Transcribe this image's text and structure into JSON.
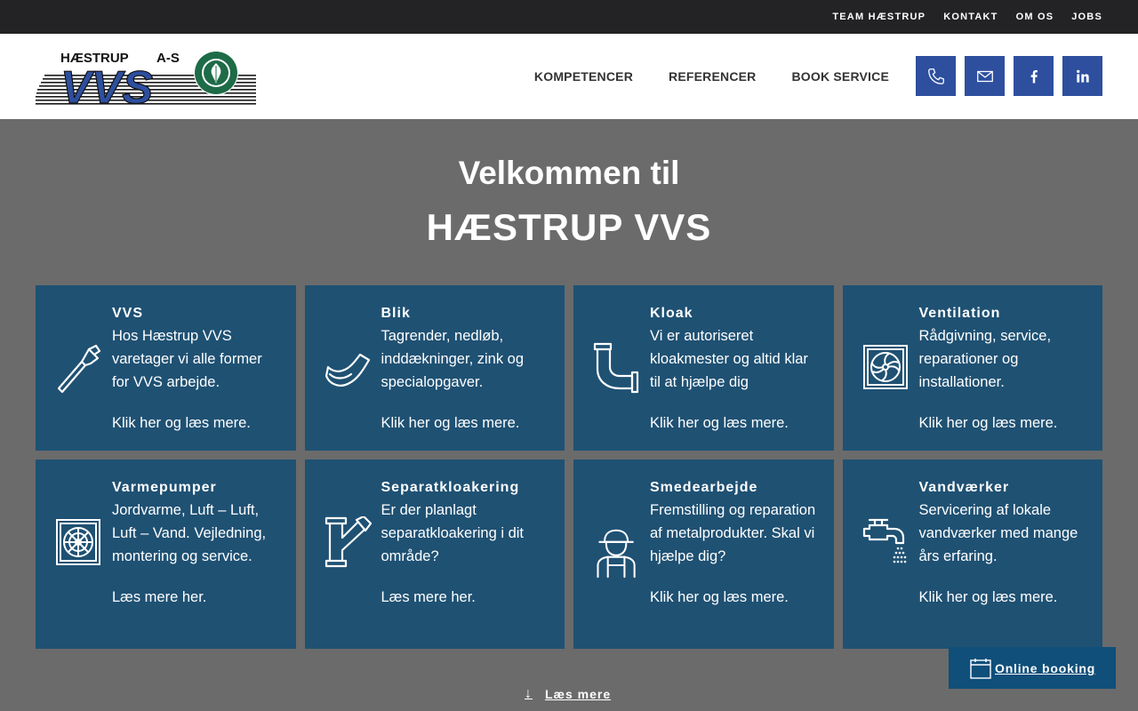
{
  "topnav": [
    "TEAM HÆSTRUP",
    "KONTAKT",
    "OM OS",
    "JOBS"
  ],
  "logo": {
    "text_top": "HÆSTRUP",
    "text_suffix": "A-S",
    "text_main": "VVS",
    "brand_color": "#2d4f9e"
  },
  "mainnav": [
    "KOMPETENCER",
    "REFERENCER",
    "BOOK SERVICE"
  ],
  "socials": [
    {
      "icon": "phone-icon"
    },
    {
      "icon": "mail-icon"
    },
    {
      "icon": "facebook-icon"
    },
    {
      "icon": "linkedin-icon"
    }
  ],
  "hero": {
    "line1": "Velkommen til",
    "line2": "HÆSTRUP VVS"
  },
  "cards": [
    {
      "title": "VVS",
      "text": "Hos Hæstrup VVS varetager vi alle former for VVS arbejde.",
      "link": "Klik her og læs mere.",
      "icon": "pipe-wrench-icon"
    },
    {
      "title": "Blik",
      "text": "Tagrender, nedløb, inddækninger, zink og specialopgaver.",
      "link": "Klik her og læs mere.",
      "icon": "gutter-icon"
    },
    {
      "title": "Kloak",
      "text": "Vi er autoriseret kloakmester og altid klar til at hjælpe dig",
      "link": "Klik her og læs mere.",
      "icon": "pipe-elbow-icon"
    },
    {
      "title": "Ventilation",
      "text": "Rådgivning, service, reparationer og installationer.",
      "link": "Klik her og læs mere.",
      "icon": "ventilation-fan-icon"
    },
    {
      "title": "Varmepumper",
      "text": "Jordvarme, Luft – Luft, Luft – Vand. Vejledning, montering og service.",
      "link": "Læs mere her.",
      "icon": "heat-pump-icon"
    },
    {
      "title": "Separatkloakering",
      "text": "Er der planlagt separatkloakering i dit område?",
      "link": "Læs mere her.",
      "icon": "y-pipe-icon"
    },
    {
      "title": "Smedearbejde",
      "text": "Fremstilling og reparation af metalprodukter. Skal vi hjælpe dig?",
      "link": "Klik her og læs mere.",
      "icon": "worker-icon"
    },
    {
      "title": "Vandværker",
      "text": "Servicering af lokale vandværker med mange års erfaring.",
      "link": "Klik her og læs mere.",
      "icon": "water-tap-icon"
    }
  ],
  "readmore": "Læs mere",
  "booking": "Online booking",
  "colors": {
    "card_bg": "#1f5173",
    "page_bg": "#6b6b6b",
    "topbar_bg": "#232326",
    "social_bg": "#2d4f9e",
    "booking_bg": "#0f4f7a"
  }
}
